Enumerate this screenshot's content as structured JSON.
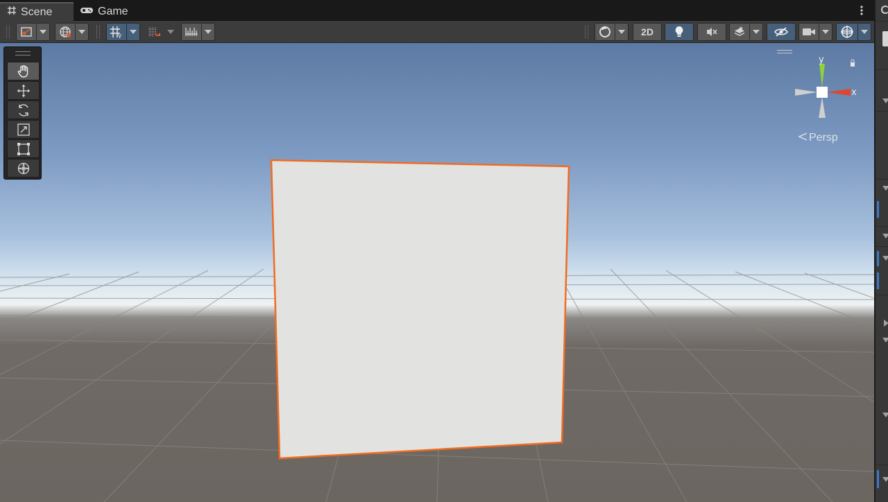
{
  "tabs": [
    {
      "label": "Scene",
      "icon": "grid-hash-icon",
      "active": true
    },
    {
      "label": "Game",
      "icon": "gamepad-icon",
      "active": false
    }
  ],
  "toolbar": {
    "left": [
      {
        "name": "draw-mode-dropdown",
        "icon": "draw-mode-icon"
      },
      {
        "name": "global-local-dropdown",
        "icon": "globe-icon"
      },
      {
        "name": "grid-snapping-toggle",
        "icon": "grid-snap-icon",
        "active": true
      },
      {
        "name": "increment-snap-toggle",
        "icon": "magnet-grid-icon"
      },
      {
        "name": "snap-settings-dropdown",
        "icon": "ruler-icon"
      }
    ],
    "right": [
      {
        "name": "shading-mode-dropdown",
        "icon": "sphere-icon"
      },
      {
        "name": "2d-toggle",
        "label": "2D"
      },
      {
        "name": "lighting-toggle",
        "icon": "lightbulb-icon",
        "active": true
      },
      {
        "name": "audio-toggle",
        "icon": "mute-icon"
      },
      {
        "name": "effects-dropdown",
        "icon": "layers-icon"
      },
      {
        "name": "scene-visibility-toggle",
        "icon": "eye-slash-icon",
        "active": true
      },
      {
        "name": "scene-camera-dropdown",
        "icon": "camera-icon"
      },
      {
        "name": "gizmos-dropdown",
        "icon": "gizmo-sphere-icon",
        "active": true
      }
    ],
    "label_2d": "2D"
  },
  "tools": [
    {
      "name": "view-tool",
      "icon": "hand-icon",
      "active": true
    },
    {
      "name": "move-tool",
      "icon": "move-arrows-icon"
    },
    {
      "name": "rotate-tool",
      "icon": "rotate-icon"
    },
    {
      "name": "scale-tool",
      "icon": "scale-icon"
    },
    {
      "name": "rect-tool",
      "icon": "rect-icon"
    },
    {
      "name": "transform-tool",
      "icon": "transform-icon"
    }
  ],
  "gizmo": {
    "y_label": "y",
    "x_label": "x",
    "projection_label": "Persp",
    "colors": {
      "y": "#8fd13a",
      "x": "#e0452f",
      "neutral": "#cfcfcf"
    }
  },
  "scene": {
    "selected_object": "quad",
    "selection_outline_color": "#f26b21",
    "quad_fill": "#e2e2e0"
  }
}
